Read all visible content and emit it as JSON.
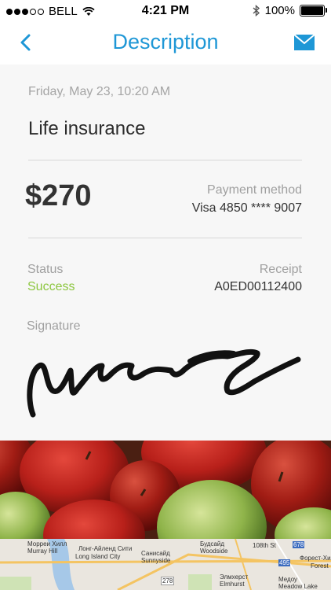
{
  "status_bar": {
    "carrier": "BELL",
    "time": "4:21 PM",
    "battery_percent": "100%",
    "battery_level": 1.0,
    "signal_bars_filled": 3,
    "signal_bars_total": 5
  },
  "navbar": {
    "title": "Description",
    "back_icon": "chevron-left-icon",
    "action_icon": "mail-icon",
    "accent_color": "#1e97d6"
  },
  "transaction": {
    "date": "Friday, May 23, 10:20 AM",
    "title": "Life insurance",
    "amount": "$270",
    "payment_method_label": "Payment method",
    "payment_method_value": "Visa 4850 **** 9007",
    "status_label": "Status",
    "status_value": "Success",
    "status_color": "#8cc63f",
    "receipt_label": "Receipt",
    "receipt_value": "A0ED00112400",
    "signature_label": "Signature"
  },
  "map": {
    "labels": [
      "Морреи Хилл",
      "Murray Hill",
      "Лонг-Айленд Сити",
      "Long Island City",
      "Санисайд",
      "Sunnyside",
      "Будсайд",
      "Woodside",
      "Элмхерст",
      "Elmhurst",
      "108th St",
      "Форест-Хилс",
      "Forest",
      "278",
      "495",
      "678",
      "Медоу",
      "Meadow Lake"
    ]
  }
}
